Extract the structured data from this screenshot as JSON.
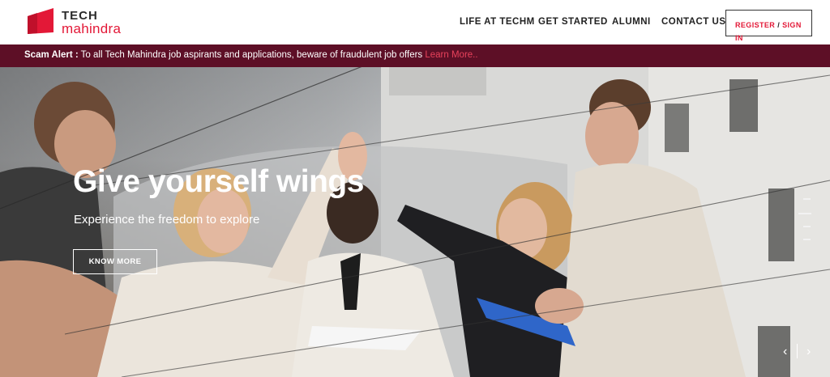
{
  "logo": {
    "line1": "TECH",
    "line2": "mahindra",
    "brand_red": "#e31837"
  },
  "nav": {
    "items": [
      "LIFE AT TECHM",
      "GET STARTED",
      "ALUMNI",
      "CONTACT US"
    ],
    "register": "REGISTER",
    "sign_in": "SIGN IN",
    "separator": "/"
  },
  "scam_alert": {
    "label": "Scam Alert :",
    "text": " To all Tech Mahindra job aspirants and applications, beware of fraudulent job offers ",
    "link": "Learn More..",
    "bar_color": "#5d0f26"
  },
  "hero": {
    "title": "Give yourself wings",
    "subtitle": "Experience the freedom to explore",
    "cta": "KNOW MORE",
    "slide_count": 4,
    "active_slide": 1,
    "prev_icon": "‹",
    "next_icon": "›"
  }
}
